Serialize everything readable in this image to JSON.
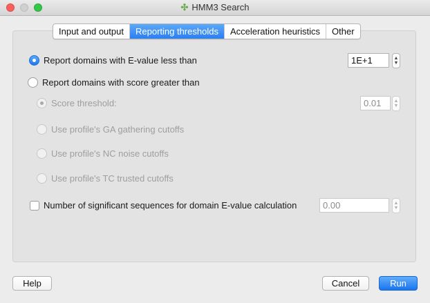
{
  "window": {
    "title": "HMM3 Search",
    "app_icon": "dna-icon"
  },
  "tabs": [
    {
      "label": "Input and output",
      "active": false
    },
    {
      "label": "Reporting thresholds",
      "active": true
    },
    {
      "label": "Acceleration heuristics",
      "active": false
    },
    {
      "label": "Other",
      "active": false
    }
  ],
  "options": {
    "evalue_label": "Report domains with E-value less than",
    "evalue_value": "1E+1",
    "score_label": "Report domains with score greater than",
    "score_threshold_label": "Score threshold:",
    "score_threshold_value": "0.01",
    "ga_label": "Use profile's GA gathering cutoffs",
    "nc_label": "Use profile's NC noise cutoffs",
    "tc_label": "Use profile's TC trusted cutoffs",
    "significant_label": "Number of significant sequences for domain E-value calculation",
    "significant_value": "0.00"
  },
  "buttons": {
    "help": "Help",
    "cancel": "Cancel",
    "run": "Run"
  },
  "colors": {
    "accent": "#2b7ff0",
    "close": "#fc605c",
    "zoom": "#34c84a"
  }
}
